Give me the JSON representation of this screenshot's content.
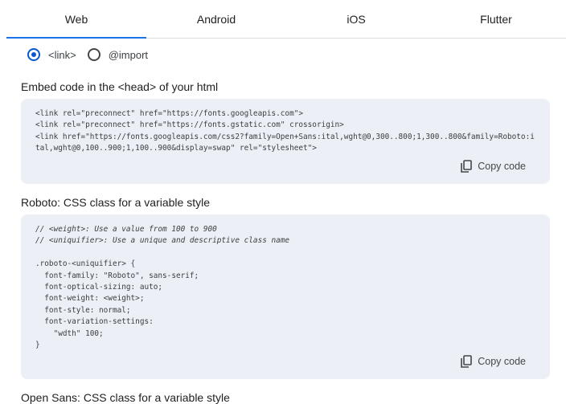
{
  "tabs": [
    "Web",
    "Android",
    "iOS",
    "Flutter"
  ],
  "radios": [
    {
      "label": "<link>",
      "selected": true
    },
    {
      "label": "@import",
      "selected": false
    }
  ],
  "embed": {
    "heading": "Embed code in the <head> of your html",
    "lines": [
      "<link rel=\"preconnect\" href=\"https://fonts.googleapis.com\">",
      "<link rel=\"preconnect\" href=\"https://fonts.gstatic.com\" crossorigin>",
      "<link href=\"https://fonts.googleapis.com/css2?family=Open+Sans:ital,wght@0,300..800;1,300..800&family=Roboto:i",
      "tal,wght@0,100..900;1,100..900&display=swap\" rel=\"stylesheet\">"
    ],
    "copy_label": "Copy code"
  },
  "roboto": {
    "heading": "Roboto: CSS class for a variable style",
    "comment_lines": [
      "// <weight>: Use a value from 100 to 900",
      "// <uniquifier>: Use a unique and descriptive class name"
    ],
    "lines": [
      ".roboto-<uniquifier> {",
      "  font-family: \"Roboto\", sans-serif;",
      "  font-optical-sizing: auto;",
      "  font-weight: <weight>;",
      "  font-style: normal;",
      "  font-variation-settings:",
      "    \"wdth\" 100;",
      "}"
    ],
    "copy_label": "Copy code"
  },
  "opensans": {
    "heading": "Open Sans: CSS class for a variable style"
  }
}
